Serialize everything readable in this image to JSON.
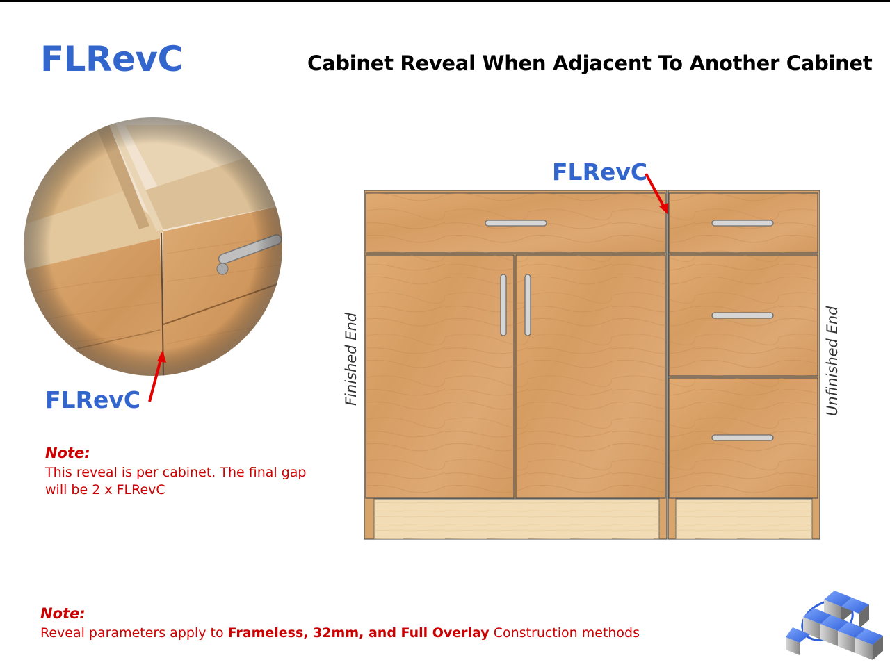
{
  "header": {
    "title": "FLRevC",
    "subtitle": "Cabinet Reveal When Adjacent To Another Cabinet"
  },
  "detail": {
    "label": "FLRevC",
    "note_heading": "Note:",
    "note_text": "This reveal is per cabinet. The final gap will be 2 x FLRevC"
  },
  "elevation": {
    "label": "FLRevC",
    "left_end_label": "Finished End",
    "right_end_label": "Unfinished End"
  },
  "footer": {
    "note_heading": "Note:",
    "note_prefix": "Reveal parameters apply to ",
    "note_bold": "Frameless,  32mm,  and Full Overlay",
    "note_suffix": " Construction  methods"
  },
  "colors": {
    "title_blue": "#3366cc",
    "note_red": "#cc0000",
    "wood": "#d9a46a",
    "toe_kick": "#f2dcb5",
    "arrow_red": "#e60000"
  }
}
